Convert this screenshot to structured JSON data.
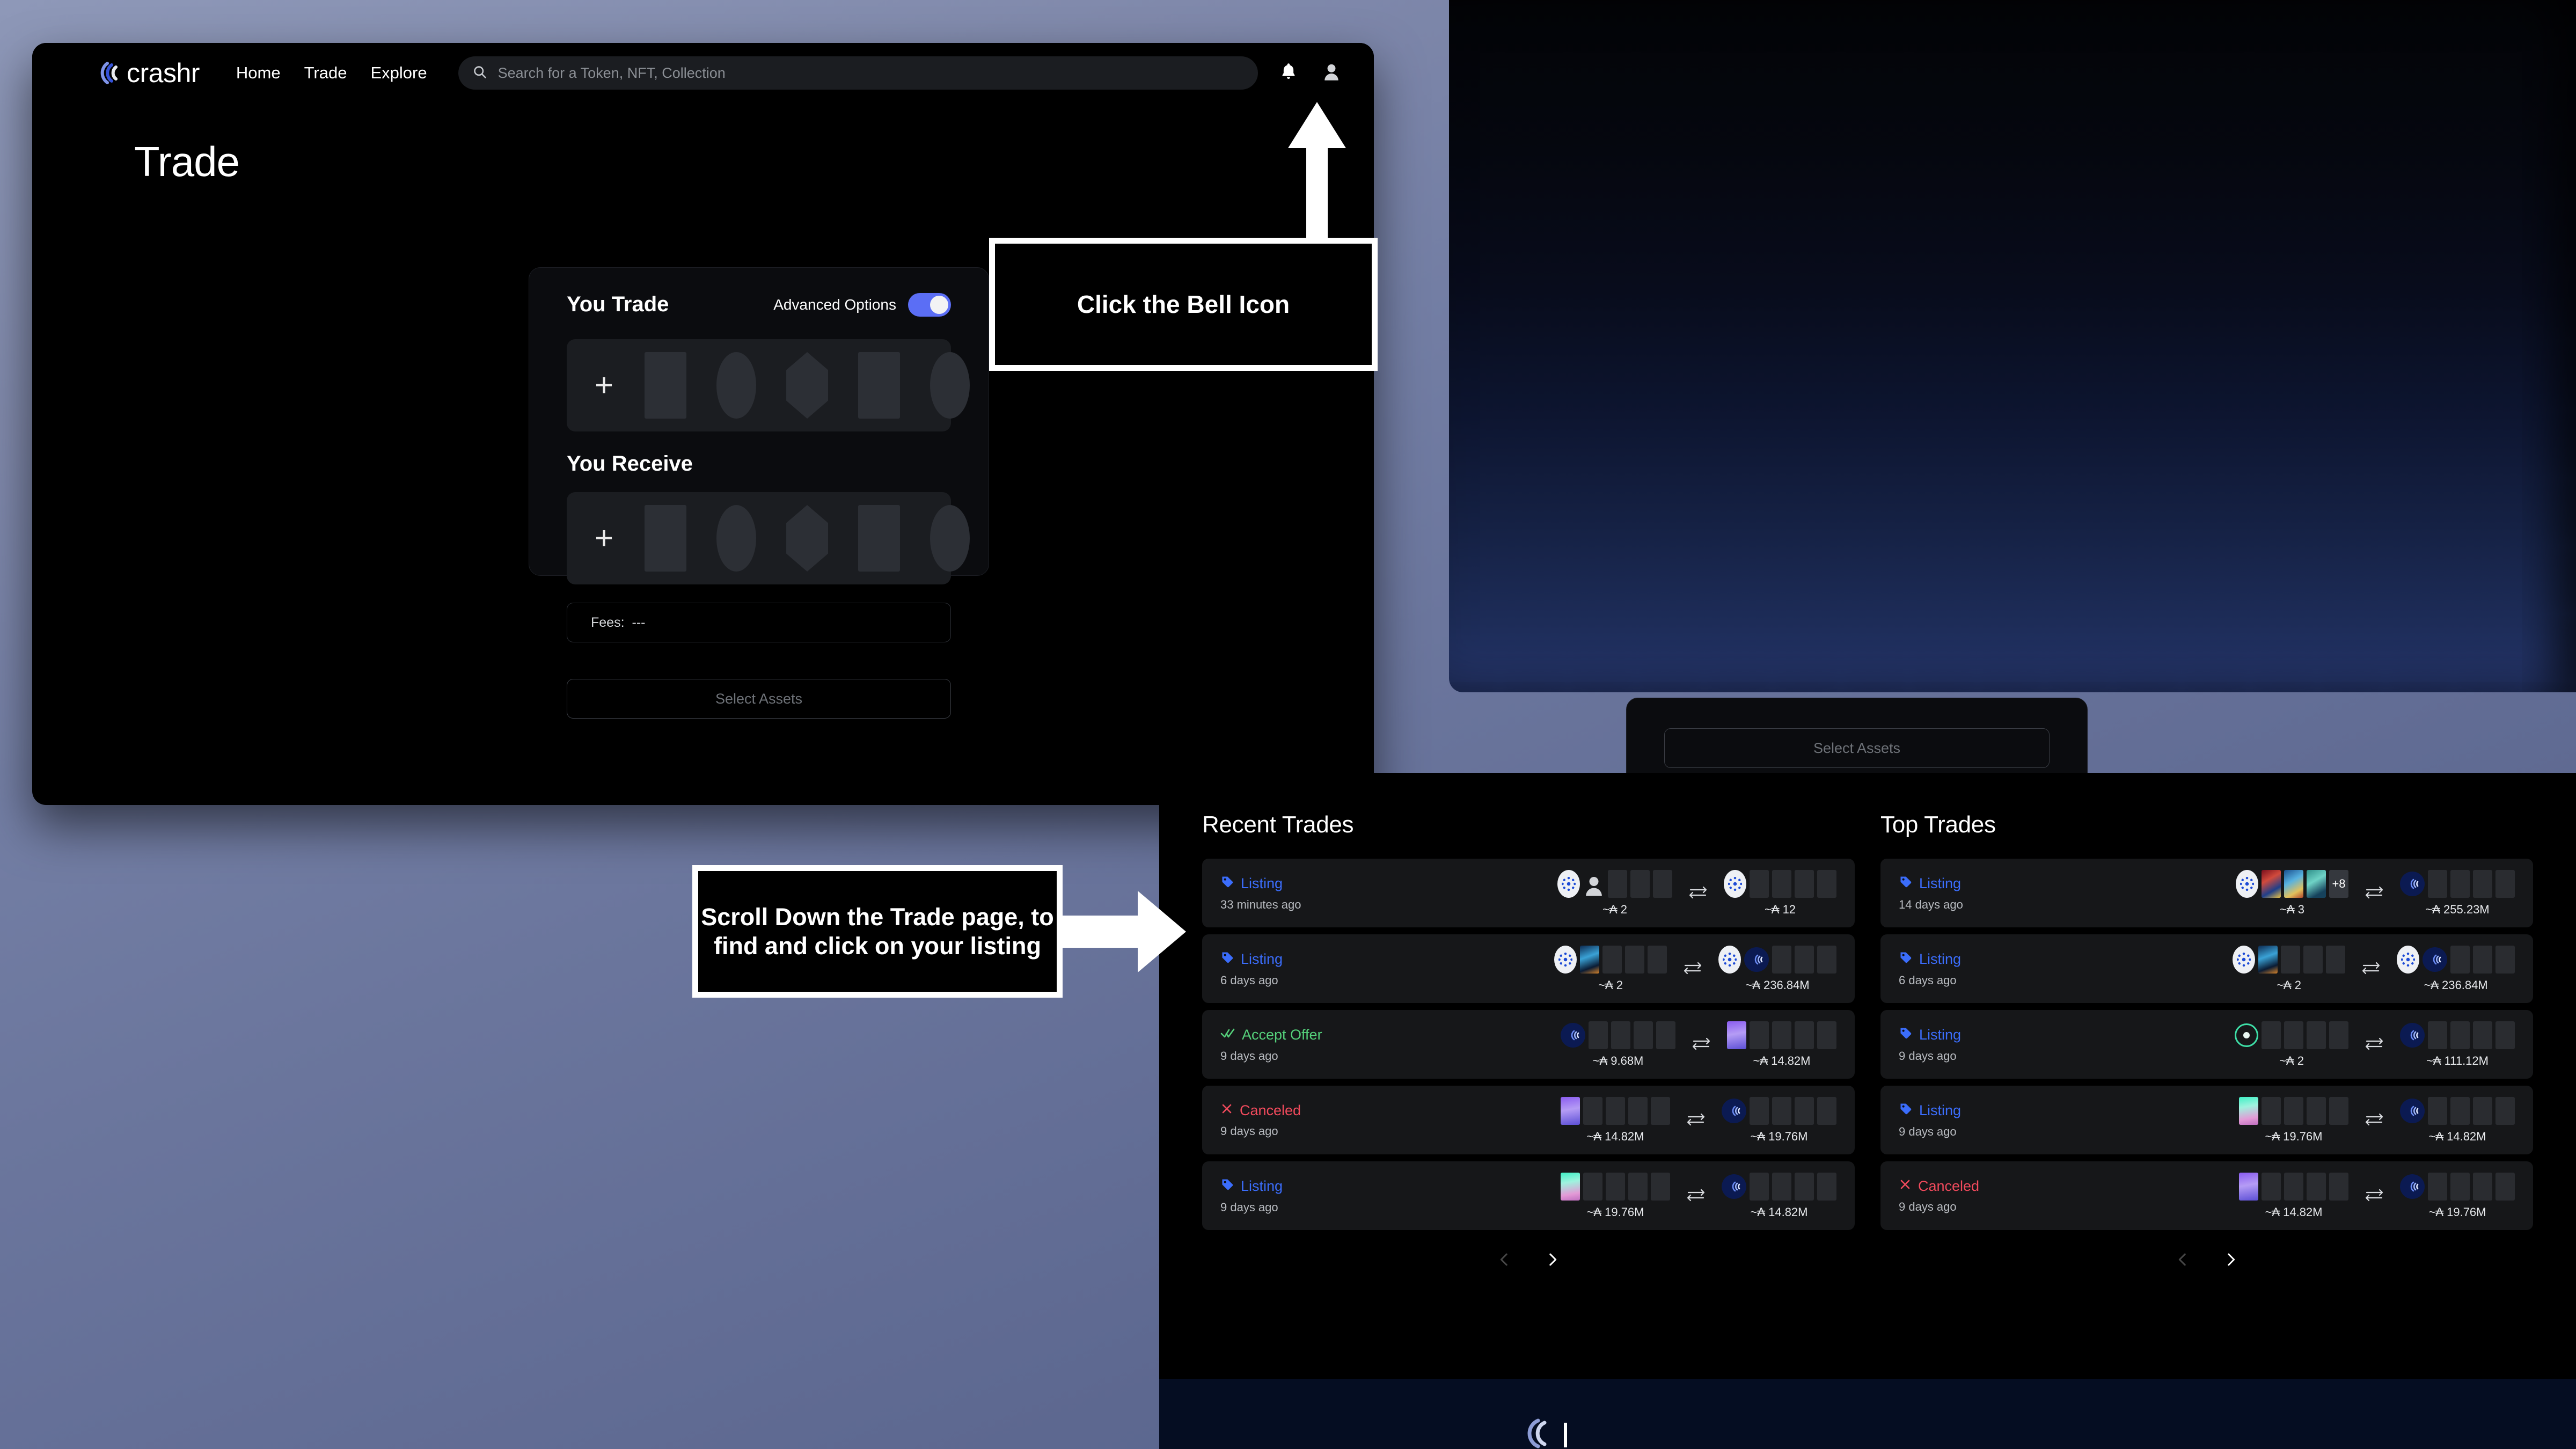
{
  "app": {
    "brand_name": "crashr",
    "brand_logo_icon": "crashr-wave-logo",
    "accent_blue": "#3b6dfb",
    "toggle_on_color": "#5b6ef5",
    "status_colors": {
      "listing": "#3b6dfb",
      "accept_offer": "#55d17b",
      "canceled": "#f04a5c"
    }
  },
  "nav": {
    "links": [
      {
        "label": "Home"
      },
      {
        "label": "Trade"
      },
      {
        "label": "Explore"
      }
    ],
    "search": {
      "icon": "search-icon",
      "placeholder": "Search for a Token, NFT, Collection",
      "value": ""
    },
    "icons": [
      {
        "name": "bell-icon"
      },
      {
        "name": "user-avatar-icon"
      }
    ]
  },
  "page": {
    "title": "Trade"
  },
  "trade_card": {
    "you_trade_label": "You Trade",
    "advanced_options_label": "Advanced Options",
    "advanced_options_on": true,
    "you_receive_label": "You Receive",
    "add_icon": "plus-icon",
    "fees_label": "Fees:",
    "fees_value": "---",
    "select_assets_label": "Select Assets"
  },
  "background_card": {
    "select_assets_label": "Select Assets"
  },
  "callouts": [
    {
      "id": "bell",
      "text": "Click the Bell Icon",
      "arrow": "arrow-up-icon"
    },
    {
      "id": "scroll",
      "text": "Scroll Down the Trade page, to find and click on your listing",
      "arrow": "arrow-right-icon"
    }
  ],
  "trades": {
    "recent": {
      "title": "Recent Trades",
      "rows": [
        {
          "status": "Listing",
          "status_type": "listing",
          "status_icon": "tag-icon",
          "time": "33 minutes ago",
          "give": {
            "amount": "~₳ 2",
            "thumbs": [
              "ada",
              "person",
              "empty",
              "empty",
              "empty"
            ]
          },
          "swap_icon": "swap-icon",
          "get": {
            "amount": "~₳ 12",
            "thumbs": [
              "ada",
              "empty",
              "empty",
              "empty",
              "empty"
            ]
          }
        },
        {
          "status": "Listing",
          "status_type": "listing",
          "status_icon": "tag-icon",
          "time": "6 days ago",
          "give": {
            "amount": "~₳ 2",
            "thumbs": [
              "ada",
              "art1",
              "empty",
              "empty",
              "empty"
            ]
          },
          "swap_icon": "swap-icon",
          "get": {
            "amount": "~₳ 236.84M",
            "thumbs": [
              "ada",
              "crashr",
              "empty",
              "empty",
              "empty"
            ]
          }
        },
        {
          "status": "Accept Offer",
          "status_type": "accept",
          "status_icon": "double-check-icon",
          "time": "9 days ago",
          "give": {
            "amount": "~₳ 9.68M",
            "thumbs": [
              "crashr",
              "empty",
              "empty",
              "empty",
              "empty"
            ]
          },
          "swap_icon": "swap-icon",
          "get": {
            "amount": "~₳ 14.82M",
            "thumbs": [
              "purple",
              "empty",
              "empty",
              "empty",
              "empty"
            ]
          }
        },
        {
          "status": "Canceled",
          "status_type": "canceled",
          "status_icon": "x-icon",
          "time": "9 days ago",
          "give": {
            "amount": "~₳ 14.82M",
            "thumbs": [
              "purple",
              "empty",
              "empty",
              "empty",
              "empty"
            ]
          },
          "swap_icon": "swap-icon",
          "get": {
            "amount": "~₳ 19.76M",
            "thumbs": [
              "crashr",
              "empty",
              "empty",
              "empty",
              "empty"
            ]
          }
        },
        {
          "status": "Listing",
          "status_type": "listing",
          "status_icon": "tag-icon",
          "time": "9 days ago",
          "give": {
            "amount": "~₳ 19.76M",
            "thumbs": [
              "mint",
              "empty",
              "empty",
              "empty",
              "empty"
            ]
          },
          "swap_icon": "swap-icon",
          "get": {
            "amount": "~₳ 14.82M",
            "thumbs": [
              "crashr",
              "empty",
              "empty",
              "empty",
              "empty"
            ]
          }
        }
      ],
      "pager": {
        "prev_icon": "chevron-left-icon",
        "prev_disabled": true,
        "next_icon": "chevron-right-icon",
        "next_disabled": false
      }
    },
    "top": {
      "title": "Top Trades",
      "rows": [
        {
          "status": "Listing",
          "status_type": "listing",
          "status_icon": "tag-icon",
          "time": "14 days ago",
          "give": {
            "amount": "~₳ 3",
            "thumbs": [
              "ada",
              "art2",
              "art3",
              "art4",
              "more:+8"
            ]
          },
          "swap_icon": "swap-icon",
          "get": {
            "amount": "~₳ 255.23M",
            "thumbs": [
              "crashr",
              "empty",
              "empty",
              "empty",
              "empty"
            ]
          }
        },
        {
          "status": "Listing",
          "status_type": "listing",
          "status_icon": "tag-icon",
          "time": "6 days ago",
          "give": {
            "amount": "~₳ 2",
            "thumbs": [
              "ada",
              "art1",
              "empty",
              "empty",
              "empty"
            ]
          },
          "swap_icon": "swap-icon",
          "get": {
            "amount": "~₳ 236.84M",
            "thumbs": [
              "ada",
              "crashr",
              "empty",
              "empty",
              "empty"
            ]
          }
        },
        {
          "status": "Listing",
          "status_type": "listing",
          "status_icon": "tag-icon",
          "time": "9 days ago",
          "give": {
            "amount": "~₳ 2",
            "thumbs": [
              "ring",
              "empty",
              "empty",
              "empty",
              "empty"
            ]
          },
          "swap_icon": "swap-icon",
          "get": {
            "amount": "~₳ 111.12M",
            "thumbs": [
              "crashr",
              "empty",
              "empty",
              "empty",
              "empty"
            ]
          }
        },
        {
          "status": "Listing",
          "status_type": "listing",
          "status_icon": "tag-icon",
          "time": "9 days ago",
          "give": {
            "amount": "~₳ 19.76M",
            "thumbs": [
              "mint",
              "empty",
              "empty",
              "empty",
              "empty"
            ]
          },
          "swap_icon": "swap-icon",
          "get": {
            "amount": "~₳ 14.82M",
            "thumbs": [
              "crashr",
              "empty",
              "empty",
              "empty",
              "empty"
            ]
          }
        },
        {
          "status": "Canceled",
          "status_type": "canceled",
          "status_icon": "x-icon",
          "time": "9 days ago",
          "give": {
            "amount": "~₳ 14.82M",
            "thumbs": [
              "purple",
              "empty",
              "empty",
              "empty",
              "empty"
            ]
          },
          "swap_icon": "swap-icon",
          "get": {
            "amount": "~₳ 19.76M",
            "thumbs": [
              "crashr",
              "empty",
              "empty",
              "empty",
              "empty"
            ]
          }
        }
      ],
      "pager": {
        "prev_icon": "chevron-left-icon",
        "prev_disabled": true,
        "next_icon": "chevron-right-icon",
        "next_disabled": false
      }
    }
  }
}
